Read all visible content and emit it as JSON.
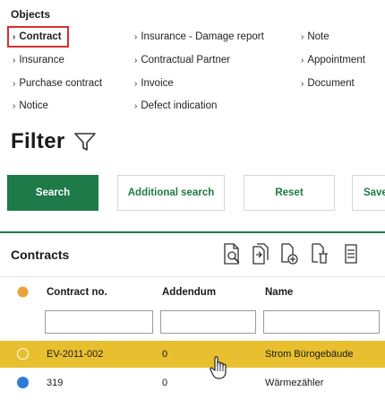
{
  "objects": {
    "title": "Objects",
    "links": [
      "Contract",
      "Insurance - Damage report",
      "Note",
      "Insurance",
      "Contractual Partner",
      "Appointment",
      "Purchase contract",
      "Invoice",
      "Document",
      "Notice",
      "Defect indication"
    ]
  },
  "filter": {
    "title": "Filter",
    "search_label": "Search",
    "additional_search_label": "Additional search",
    "reset_label": "Reset",
    "save_label": "Save"
  },
  "contracts": {
    "title": "Contracts",
    "toolbar_icons": [
      "search-document-icon",
      "copy-document-icon",
      "add-document-icon",
      "delete-document-icon",
      "list-document-icon"
    ],
    "columns": [
      "Contract no.",
      "Addendum",
      "Name"
    ],
    "rows": [
      {
        "contract_no": "EV-2011-002",
        "addendum": "0",
        "name": "Strom Bürogebäude",
        "status_color": "#e8bf2f",
        "selected": true
      },
      {
        "contract_no": "319",
        "addendum": "0",
        "name": "Wärmezähler",
        "status_color": "#2d7ad6",
        "selected": false
      }
    ]
  },
  "colors": {
    "accent": "#1e7a48",
    "selected_row": "#e8bf2f",
    "active_border": "#d32f2f",
    "status_orange": "#e8a33a",
    "status_blue": "#2d7ad6"
  }
}
